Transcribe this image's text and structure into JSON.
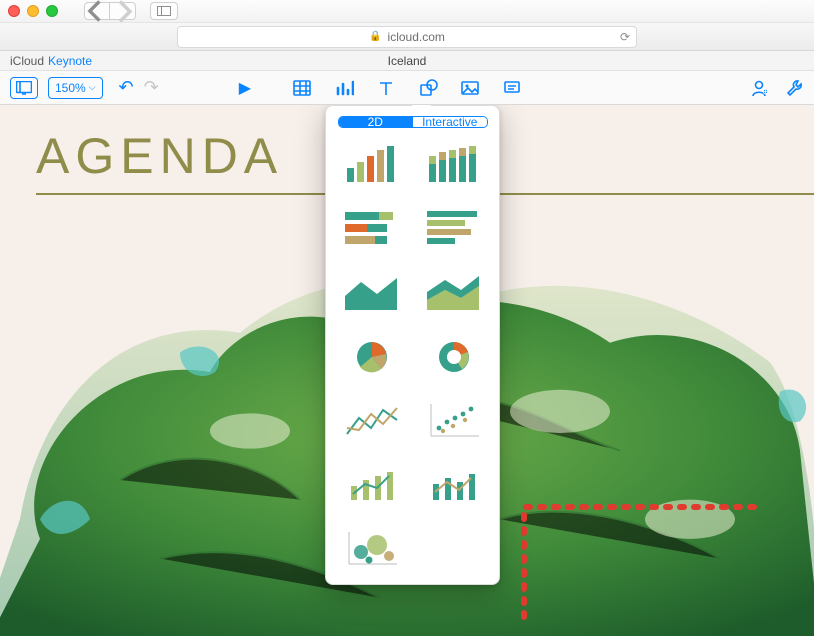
{
  "browser": {
    "url_host": "icloud.com"
  },
  "app": {
    "brand": "iCloud",
    "name": "Keynote",
    "document": "Iceland"
  },
  "toolbar": {
    "zoom": "150%"
  },
  "slide": {
    "title": "AGENDA"
  },
  "chart_popover": {
    "tabs": {
      "active": "2D",
      "inactive": "Interactive"
    },
    "types": [
      "bar-vertical",
      "bar-vertical-stacked",
      "bar-horizontal-stacked",
      "bar-horizontal",
      "area",
      "area-stacked",
      "pie",
      "donut",
      "line-multi",
      "scatter",
      "combo-bar-line",
      "combo-bar-line-2",
      "bubble"
    ]
  },
  "colors": {
    "accent": "#0a84ff",
    "olive": "#8f8d49",
    "teal": "#37a08a",
    "orange": "#e06a2b",
    "tan": "#c0a66a",
    "route": "#e03b2f"
  }
}
